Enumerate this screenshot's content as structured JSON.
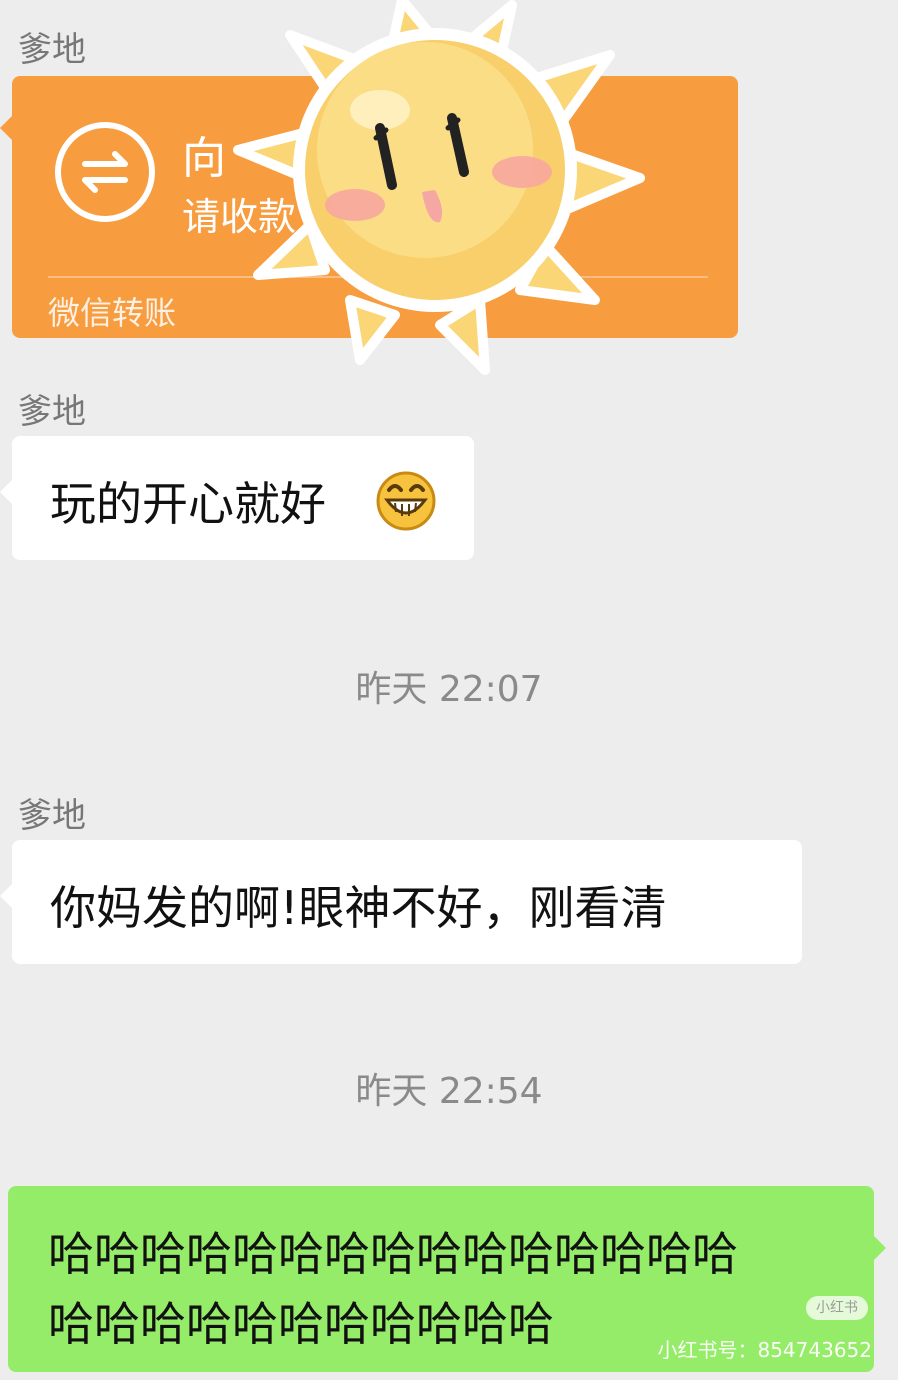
{
  "messages": [
    {
      "sender": "爹地",
      "type": "transfer",
      "transfer": {
        "title": "向",
        "subtitle": "请收款",
        "label": "微信转账"
      }
    },
    {
      "sender": "爹地",
      "type": "text",
      "text": "玩的开心就好",
      "emoji": "grinning-face"
    },
    {
      "type": "timestamp",
      "text": "昨天 22:07"
    },
    {
      "sender": "爹地",
      "type": "text",
      "text": "你妈发的啊!眼神不好，刚看清"
    },
    {
      "type": "timestamp",
      "text": "昨天 22:54"
    },
    {
      "sender": "me",
      "type": "text",
      "lines": [
        "哈哈哈哈哈哈哈哈哈哈哈哈哈哈哈",
        "哈哈哈哈哈哈哈哈哈哈哈"
      ]
    }
  ],
  "overlay": {
    "sticker": "sun-face-sticker"
  },
  "watermark": {
    "badge": "小红书",
    "text": "小红书号：854743652"
  },
  "colors": {
    "background": "#ededed",
    "transfer_bubble": "#f79c3f",
    "received_bubble": "#ffffff",
    "sent_bubble": "#95ec69"
  }
}
